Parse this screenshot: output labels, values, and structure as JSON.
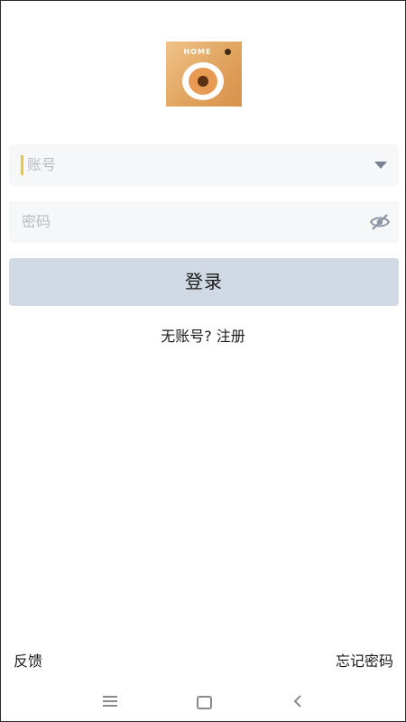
{
  "app": {
    "logo_text": "HOME"
  },
  "login_form": {
    "account_placeholder": "账号",
    "password_placeholder": "密码",
    "login_label": "登录",
    "register_label": "无账号? 注册"
  },
  "footer": {
    "feedback_label": "反馈",
    "forgot_password_label": "忘记密码"
  },
  "icons": {
    "logo": "camera-logo-icon",
    "account_dropdown": "triangle-down-icon",
    "password_visibility": "eye-off-icon",
    "nav_menu": "menu-icon",
    "nav_home": "home-icon",
    "nav_back": "back-icon"
  },
  "colors": {
    "logo_orange": "#e0a45f",
    "login_button_bg": "#d1d9e4",
    "input_bg": "#f6f7f9",
    "caret": "#e3c840"
  }
}
